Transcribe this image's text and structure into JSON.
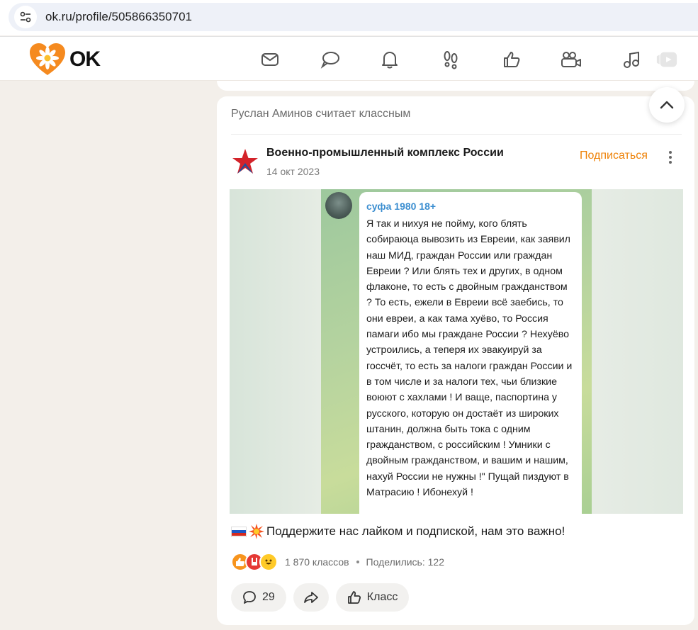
{
  "browser": {
    "url": "ok.ru/profile/505866350701"
  },
  "header": {
    "logo_text": "OK",
    "nav_icons": [
      "mail-icon",
      "chat-icon",
      "bell-icon",
      "footprints-icon",
      "thumbs-up-icon",
      "video-camera-icon",
      "music-note-icon",
      "video-play-icon"
    ]
  },
  "post": {
    "activity": "Руслан Аминов считает классным",
    "group_name": "Военно-промышленный комплекс России",
    "date": "14 окт 2023",
    "subscribe_label": "Подписаться",
    "image": {
      "author": "суфа 1980 18+",
      "text": "Я так и нихуя не пойму, кого блять собираюца вывозить из Евреии, как заявил наш МИД, граждан России или граждан Евреии ? Или блять тех и других, в одном флаконе, то есть с двойным гражданством ? То есть, ежели в Евреии всё заебись, то они евреи, а как тама хуёво, то Россия памаги ибо мы граждане России ? Нехуёво устроились, а теперя их эвакуируй за госсчёт, то есть за налоги граждан России и в том числе и за налоги тех, чьи близкие воюют с хахлами ! И ваще, паспортина у русского, которую он достаёт из широких штанин, должна быть тока с одним гражданством, с российским ! Умники с двойным гражданством, и вашим и нашим, нахуй России не нужны !\" Пущай пиздуют в Матрасию ! Ибонехуй !"
    },
    "caption": "Поддержите нас лайком и подпиской, нам это важно!",
    "likes": "1 870 классов",
    "shares": "Поделились: 122",
    "comments_count": "29",
    "class_label": "Класс"
  },
  "colors": {
    "accent": "#ee8208",
    "link": "#3b8ed0"
  }
}
